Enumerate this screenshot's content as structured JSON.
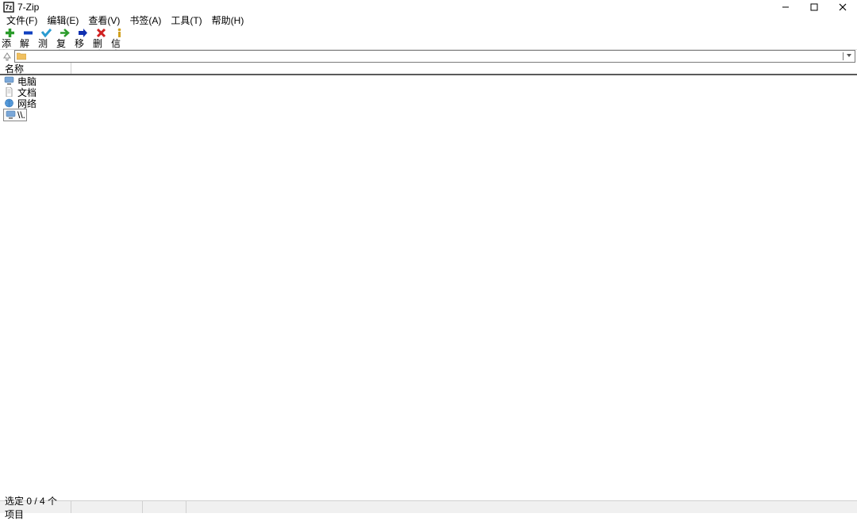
{
  "window": {
    "title": "7-Zip"
  },
  "menu": {
    "items": [
      "文件(F)",
      "编辑(E)",
      "查看(V)",
      "书签(A)",
      "工具(T)",
      "帮助(H)"
    ]
  },
  "toolbar": {
    "buttons": [
      {
        "label": "添加",
        "icon": "plus",
        "color": "#2a9b2a"
      },
      {
        "label": "解压",
        "icon": "minus",
        "color": "#1040c0"
      },
      {
        "label": "测试",
        "icon": "check",
        "color": "#2a9bd0"
      },
      {
        "label": "复制",
        "icon": "arrow-right",
        "color": "#2a9b2a"
      },
      {
        "label": "移动",
        "icon": "arrow-right-bold",
        "color": "#1030b0"
      },
      {
        "label": "删除",
        "icon": "x",
        "color": "#d02020"
      },
      {
        "label": "信息",
        "icon": "info",
        "color": "#d0a020"
      }
    ]
  },
  "address": {
    "path": ""
  },
  "columns": {
    "name": "名称"
  },
  "files": [
    {
      "name": "电脑",
      "icon": "computer"
    },
    {
      "name": "文档",
      "icon": "document"
    },
    {
      "name": "网络",
      "icon": "network"
    },
    {
      "name": "\\\\.",
      "icon": "path"
    }
  ],
  "status": {
    "text": "选定 0 / 4 个项目"
  }
}
